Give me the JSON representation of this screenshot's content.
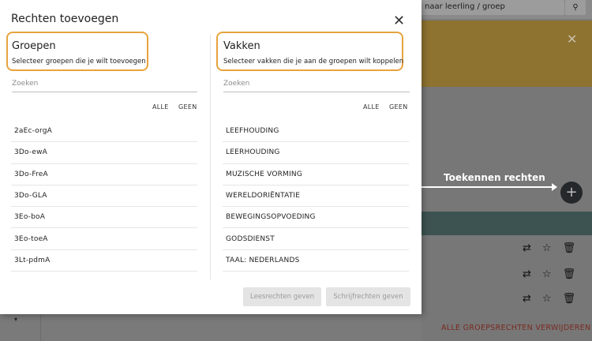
{
  "background": {
    "search_placeholder": "naar leerling / groep",
    "annotation": "Toekennen rechten",
    "bottom_link": "ALLE GROEPSRECHTEN VERWIJDEREN",
    "dropdown_caret": "▾"
  },
  "dialog": {
    "title": "Rechten toevoegen",
    "close_label": "✕",
    "groepen": {
      "title": "Groepen",
      "subtitle": "Selecteer groepen die je wilt toevoegen",
      "search_placeholder": "Zoeken",
      "all_label": "ALLE",
      "none_label": "GEEN",
      "items": [
        "2aEc-orgA",
        "3Do-ewA",
        "3Do-FreA",
        "3Do-GLA",
        "3Eo-boA",
        "3Eo-toeA",
        "3Lt-pdmA"
      ]
    },
    "vakken": {
      "title": "Vakken",
      "subtitle": "Selecteer vakken die je aan de groepen wilt koppelen",
      "search_placeholder": "Zoeken",
      "all_label": "ALLE",
      "none_label": "GEEN",
      "items": [
        "LEEFHOUDING",
        "LEERHOUDING",
        "MUZISCHE VORMING",
        "WERELDORIËNTATIE",
        "BEWEGINGSOPVOEDING",
        "GODSDIENST",
        "TAAL: NEDERLANDS"
      ]
    },
    "read_button": "Leesrechten geven",
    "write_button": "Schrijfrechten geven"
  },
  "colors": {
    "highlight": "#e8a33d",
    "banner": "#8e7230",
    "greenbar": "#3d5352",
    "danger_link": "#7a2a20"
  }
}
